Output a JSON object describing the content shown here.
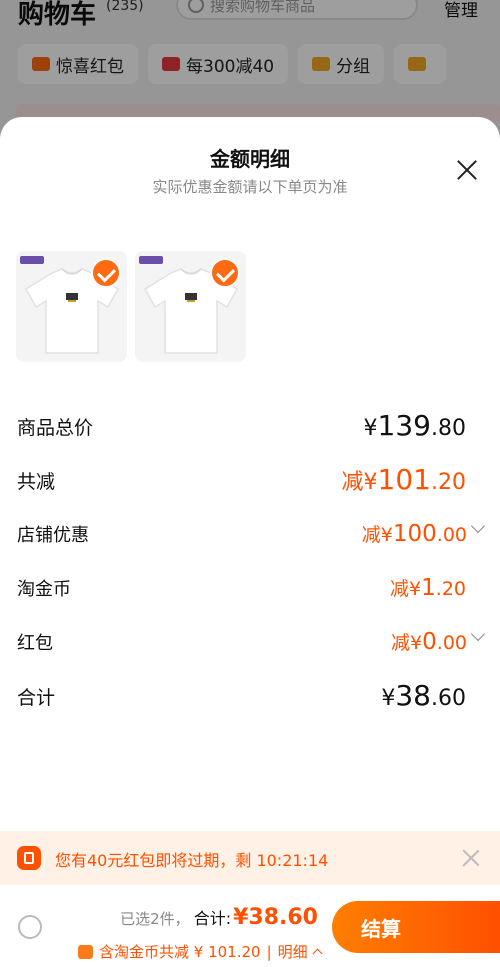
{
  "background": {
    "title": "购物车",
    "count": "(235)",
    "search_placeholder": "搜索购物车商品",
    "manage": "管理",
    "chips": [
      {
        "label": "惊喜红包",
        "color": "#ff6a13"
      },
      {
        "label": "每300减40",
        "color": "#e8383d"
      },
      {
        "label": "分组",
        "color": "#f5a623"
      }
    ]
  },
  "sheet": {
    "title": "金额明细",
    "subtitle": "实际优惠金额请以下单页为准",
    "products": [
      {
        "alt": "白色T恤"
      },
      {
        "alt": "白色T恤"
      }
    ],
    "rows": {
      "total_price": {
        "label": "商品总价",
        "currency": "¥",
        "int": "139",
        "dec": ".80"
      },
      "total_discount": {
        "label": "共减",
        "prefix": "减¥",
        "int": "101",
        "dec": ".20"
      },
      "shop_discount": {
        "label": "店铺优惠",
        "prefix": "减¥",
        "int": "100",
        "dec": ".00"
      },
      "coin": {
        "label": "淘金币",
        "prefix": "减¥",
        "int": "1",
        "dec": ".20"
      },
      "red_packet": {
        "label": "红包",
        "prefix": "减¥",
        "int": "0",
        "dec": ".00"
      },
      "sum": {
        "label": "合计",
        "currency": "¥",
        "int": "38",
        "dec": ".60"
      }
    }
  },
  "notice": {
    "text": "您有40元红包即将过期，剩 10:21:14"
  },
  "bottom_bar": {
    "selected": "已选2件，",
    "total_label": "合计:",
    "total_value": "¥38.60",
    "discount_text": "含淘金币共减 ¥ 101.20",
    "detail_label": "明细",
    "checkout_label": "结算"
  },
  "colors": {
    "accent": "#ff5000",
    "notice_bg": "#fff1e6"
  }
}
